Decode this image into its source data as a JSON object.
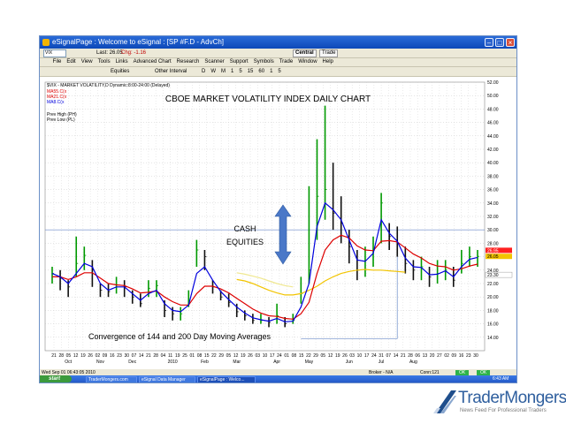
{
  "window": {
    "title": "eSignalPage : Welcome to eSignal : [SP #F.D - AdvCh]"
  },
  "toolbar": {
    "symbol": "VIX",
    "last": "Last: 26.05",
    "change": "Chg: -1.16",
    "central": "Central",
    "trade": "Trade"
  },
  "menu": {
    "items": [
      "File",
      "Edit",
      "View",
      "Tools",
      "Links",
      "Advanced Chart",
      "Research",
      "Scanner",
      "Support",
      "Symbols",
      "Trade",
      "Window",
      "Help"
    ]
  },
  "toolbar2": {
    "equities": "Equities",
    "other_interval": "Other Interval",
    "intervals": [
      "D",
      "W",
      "M",
      "1",
      "5",
      "15",
      "60",
      "1",
      "5"
    ]
  },
  "legend": {
    "header": "$VIX - MARKET VOLATILITY,D Dynamic:8:00-24:00 (Delayed)",
    "ma1": "MA55.C(x",
    "ma2": "MA21.C(x",
    "ma3": "MA8.C(x",
    "prev_high": "Prev High (PH)",
    "prev_low": "Prev Low (PL)"
  },
  "annotations": {
    "title": "CBOE MARKET VOLATILITY INDEX DAILY CHART",
    "cash": "CASH",
    "equities": "EQUITIES",
    "convergence": "Convergence of 144 and 200 Day Moving Averages"
  },
  "price_labels": {
    "upper": "26.95",
    "lower": "23.30"
  },
  "status": {
    "datetime": "Wed Sep 01 06:43:05 2010",
    "broker": "Broker - N/A",
    "conn": "Conn:121",
    "ok1": "OK",
    "ok2": "OK"
  },
  "taskbar": {
    "start": "start",
    "items": [
      "TraderMongers.com",
      "eSignal Data Manager",
      "eSignalPage : Welco..."
    ],
    "clock": "6:43 AM"
  },
  "brand": {
    "name": "TraderMongers",
    "tagline": "News Feed For Professional Traders"
  },
  "colors": {
    "up_bar": "#009900",
    "down_bar": "#111111",
    "ma_fast": "#0000dd",
    "ma_mid": "#dd0000",
    "ma_slow": "#f2c400",
    "ma_long": "#f0e890",
    "line30": "#6a8ac8",
    "arrow": "#4a78c8"
  },
  "chart_data": {
    "type": "line",
    "y_axis_side": "right",
    "ylim": [
      12,
      52
    ],
    "y_ticks": [
      "14.00",
      "16.00",
      "18.00",
      "20.00",
      "22.00",
      "24.00",
      "26.00",
      "28.00",
      "30.00",
      "32.00",
      "34.00",
      "36.00",
      "38.00",
      "40.00",
      "42.00",
      "44.00",
      "46.00",
      "48.00",
      "50.00",
      "52.00"
    ],
    "x_ticks": [
      "21",
      "28",
      "05",
      "12",
      "19",
      "26",
      "02",
      "09",
      "16",
      "23",
      "30",
      "07",
      "14",
      "21",
      "28",
      "04",
      "11",
      "19",
      "25",
      "01",
      "08",
      "15",
      "22",
      "29",
      "05",
      "12",
      "19",
      "26",
      "03",
      "10",
      "17",
      "24",
      "01",
      "08",
      "15",
      "22",
      "29",
      "05",
      "12",
      "19",
      "26",
      "03",
      "10",
      "17",
      "24",
      "31",
      "07",
      "14",
      "21",
      "28",
      "06",
      "13",
      "20",
      "27",
      "02",
      "09",
      "16",
      "23",
      "30"
    ],
    "months": [
      "Oct",
      "Nov",
      "Dec",
      "2010",
      "Feb",
      "Mar",
      "Apr",
      "May",
      "Jun",
      "Jul",
      "Aug"
    ],
    "month_x": [
      2,
      6,
      10,
      15,
      19,
      23,
      28,
      32,
      37,
      41,
      45
    ],
    "close_weekly": [
      23.5,
      22.8,
      21.5,
      25.0,
      26.2,
      24.0,
      21.0,
      20.8,
      21.8,
      21.5,
      20.0,
      19.0,
      21.3,
      21.7,
      18.0,
      17.5,
      17.5,
      19.5,
      27.0,
      26.0,
      21.5,
      20.0,
      19.2,
      17.8,
      17.2,
      16.5,
      16.5,
      16.2,
      17.2,
      16.0,
      16.5,
      20.5,
      24.0,
      35.0,
      36.0,
      32.5,
      31.0,
      27.5,
      24.0,
      25.5,
      27.0,
      34.0,
      29.0,
      28.0,
      25.0,
      24.0,
      24.5,
      23.0,
      23.5,
      24.0,
      22.5,
      25.0,
      26.0,
      26.05
    ],
    "highs_weekly": [
      24.5,
      24.0,
      22.5,
      29.0,
      27.5,
      25.5,
      22.0,
      22.0,
      23.0,
      22.5,
      21.0,
      20.5,
      22.5,
      22.5,
      19.5,
      18.5,
      18.5,
      21.0,
      28.5,
      27.0,
      22.5,
      21.0,
      20.5,
      19.0,
      18.0,
      17.5,
      17.5,
      17.0,
      19.0,
      17.0,
      17.5,
      23.0,
      36.5,
      43.5,
      48.5,
      40.0,
      35.0,
      30.0,
      27.0,
      27.5,
      29.0,
      35.5,
      31.0,
      30.5,
      27.5,
      25.5,
      26.0,
      24.5,
      25.5,
      25.5,
      24.5,
      27.0,
      27.5,
      27.0
    ],
    "lows_weekly": [
      22.0,
      21.0,
      20.0,
      23.0,
      24.0,
      21.5,
      20.0,
      20.0,
      20.5,
      20.0,
      19.0,
      18.5,
      20.0,
      20.0,
      17.0,
      16.5,
      16.5,
      18.5,
      24.5,
      24.0,
      20.5,
      19.5,
      18.5,
      17.0,
      16.5,
      16.0,
      16.0,
      15.5,
      16.0,
      15.5,
      16.0,
      19.0,
      22.0,
      28.5,
      31.5,
      30.0,
      28.0,
      25.0,
      22.5,
      23.0,
      24.5,
      28.0,
      27.0,
      26.0,
      23.5,
      22.5,
      22.5,
      21.5,
      22.0,
      22.5,
      21.5,
      23.5,
      24.5,
      24.5
    ],
    "ma_fast": [
      23.5,
      23.0,
      22.0,
      23.5,
      25.0,
      24.5,
      22.0,
      21.0,
      21.5,
      21.5,
      20.5,
      19.5,
      20.5,
      21.0,
      19.0,
      18.0,
      17.8,
      18.8,
      23.5,
      24.5,
      22.5,
      20.8,
      19.6,
      18.5,
      17.6,
      16.9,
      16.6,
      16.4,
      16.8,
      16.3,
      16.4,
      18.5,
      22.0,
      30.5,
      34.0,
      33.0,
      31.5,
      28.5,
      25.5,
      25.3,
      26.5,
      31.5,
      29.5,
      28.3,
      25.8,
      24.5,
      24.4,
      23.3,
      23.4,
      23.9,
      23.0,
      24.5,
      25.6,
      25.9
    ],
    "ma_mid": [
      23.0,
      23.0,
      22.6,
      23.0,
      23.6,
      23.6,
      22.8,
      22.0,
      21.8,
      21.7,
      21.2,
      20.6,
      20.7,
      20.9,
      20.0,
      19.3,
      18.8,
      18.8,
      20.5,
      21.6,
      21.6,
      21.2,
      20.6,
      19.8,
      19.0,
      18.2,
      17.6,
      17.2,
      17.1,
      16.8,
      16.7,
      17.5,
      19.2,
      23.5,
      27.0,
      28.5,
      29.2,
      28.8,
      27.6,
      27.0,
      26.9,
      28.3,
      28.4,
      28.2,
      27.3,
      26.4,
      25.8,
      25.0,
      24.6,
      24.5,
      24.0,
      24.2,
      24.6,
      24.9
    ],
    "ma_slow_segment": {
      "start": 23,
      "values": [
        22.6,
        22.4,
        22.0,
        21.5,
        21.0,
        20.6,
        20.3,
        20.3,
        20.5,
        21.0,
        21.6,
        22.4,
        23.0,
        23.5,
        23.8,
        24.0,
        24.1,
        24.0,
        24.0,
        23.9,
        23.8,
        23.7
      ]
    },
    "ma_long_segment": {
      "start": 23,
      "values": [
        23.6,
        23.4,
        23.1,
        22.8,
        22.4,
        22.0,
        21.7,
        21.5
      ]
    },
    "horizontal_lines": [
      30.0
    ],
    "last_value": 26.05
  }
}
